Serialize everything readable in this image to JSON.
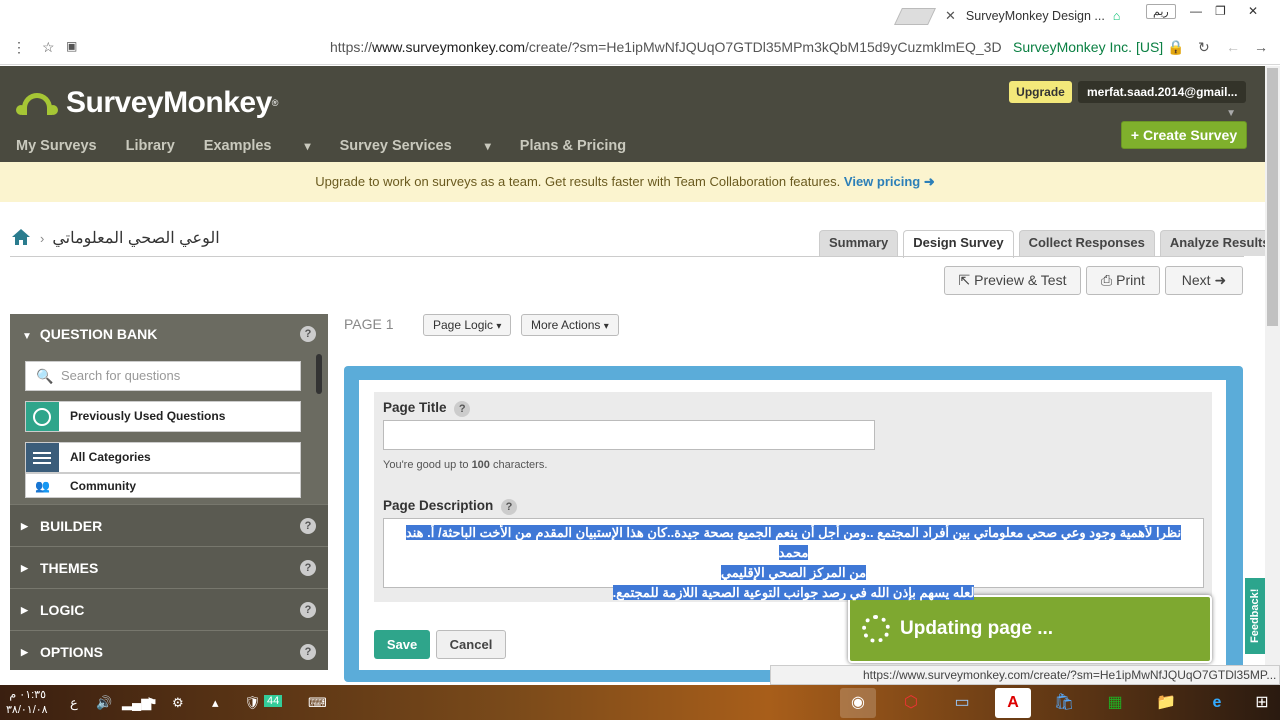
{
  "browser": {
    "tab_title": "SurveyMonkey Design ...",
    "user_chip": "ريم",
    "url_scheme": "https://",
    "url_host": "www.surveymonkey.com",
    "url_path": "/create/?sm=He1ipMwNfJQUqO7GTDl35MPm3kQbM15d9yCuzmklmEQ_3D",
    "ev_label": "SurveyMonkey Inc. [US]"
  },
  "header": {
    "logo_text": "SurveyMonkey",
    "nav": [
      "My Surveys",
      "Library",
      "Examples",
      "Survey Services",
      "Plans & Pricing"
    ],
    "upgrade_label": "Upgrade",
    "account_label": "merfat.saad.2014@gmail...",
    "create_label": "+ Create Survey"
  },
  "banner": {
    "text": "Upgrade to work on surveys as a team. Get results faster with Team Collaboration features.",
    "link": "View pricing"
  },
  "survey": {
    "title": "الوعي الصحي المعلوماتي"
  },
  "tabs": [
    "Summary",
    "Design Survey",
    "Collect Responses",
    "Analyze Results"
  ],
  "actions": {
    "preview": "Preview & Test",
    "print": "Print",
    "next": "Next"
  },
  "question_bank": {
    "title": "QUESTION BANK",
    "search_placeholder": "Search for questions",
    "items": [
      "Previously Used Questions",
      "All Categories",
      "Community"
    ]
  },
  "sections": [
    "BUILDER",
    "THEMES",
    "LOGIC",
    "OPTIONS"
  ],
  "page": {
    "label": "PAGE 1",
    "page_logic": "Page Logic",
    "more_actions": "More Actions",
    "title_label": "Page Title",
    "title_value": "",
    "char_note_prefix": "You're good up to ",
    "char_note_count": "100",
    "char_note_suffix": " characters.",
    "desc_label": "Page Description",
    "desc_lines": [
      "نظرا لأهمية وجود وعي صحي معلوماتي بين أفراد المجتمع ..ومن أجل أن ينعم الجميع بصحة جيدة..كان هذا الإستبيان المقدم من الأخت الباحثة/ أ. هند محمد",
      "من المركز الصحي الإقليمي",
      "لعله يسهم بإذن الله في رصد جوانب التوعية الصحية اللازمة للمجتمع."
    ],
    "save_label": "Save",
    "cancel_label": "Cancel"
  },
  "toast": "Updating page ...",
  "feedback": "Feedback!",
  "status_url": "https://www.surveymonkey.com/create/?sm=He1ipMwNfJQUqO7GTDl35MP...",
  "taskbar": {
    "time": "٠١:٣٥ م",
    "date": "٣٨/٠١/٠٨",
    "lang": "ع",
    "battery": "44"
  },
  "colors": {
    "header_bg": "#4a4a3f",
    "brand_green": "#7fb02c",
    "editor_blue": "#5bacd9",
    "save_teal": "#2fa58b"
  }
}
